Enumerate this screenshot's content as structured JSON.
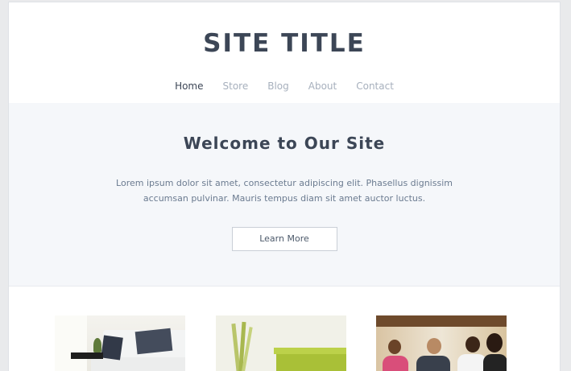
{
  "header": {
    "site_title": "SITE TITLE",
    "nav": [
      {
        "label": "Home",
        "active": true
      },
      {
        "label": "Store",
        "active": false
      },
      {
        "label": "Blog",
        "active": false
      },
      {
        "label": "About",
        "active": false
      },
      {
        "label": "Contact",
        "active": false
      }
    ]
  },
  "hero": {
    "title": "Welcome to Our Site",
    "text_line1": "Lorem ipsum dolor sit amet, consectetur adipiscing elit. Phasellus dignissim",
    "text_line2": "accumsan pulvinar. Mauris tempus diam sit amet auctor luctus.",
    "button_label": "Learn More"
  },
  "features": {
    "images": [
      "living-room-photo",
      "green-interior-photo",
      "team-meeting-photo"
    ]
  },
  "colors": {
    "title": "#3c4656",
    "nav_inactive": "#a7b0bd",
    "hero_bg": "#f5f7fa",
    "body_text": "#6b7b90"
  }
}
